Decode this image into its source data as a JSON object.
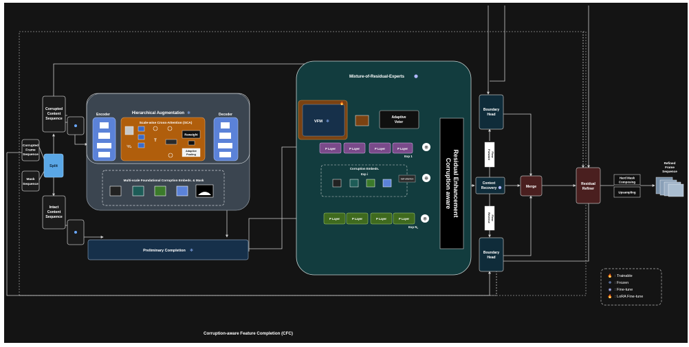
{
  "colors": {
    "canvas": "#141414",
    "panel_gray": "#3b4550",
    "panel_teal": "#123c3e",
    "box_dark": "#1b1b1b",
    "navy": "#16304a",
    "moe_box": "#0f2c3a",
    "orange": "#b05e0c",
    "encoder_blue": "#5b82d8",
    "split_blue": "#5aa7e6",
    "purple": "#7a4a8a",
    "green": "#3f6a1e",
    "maroon": "#4a1f1f",
    "line": "#cfcfcf"
  },
  "labels": {
    "corrupted_content_sequence": [
      "Corrupted",
      "Content",
      "Sequence"
    ],
    "corrupted_frame_sequence": [
      "Corrupted",
      "Frame",
      "Sequence"
    ],
    "mask_sequence": [
      "Mask",
      "Sequence"
    ],
    "split": "Split",
    "intact_content_sequence": [
      "Intact",
      "Content",
      "Sequence"
    ],
    "hierarchical_augmentation": "Hierarchical Augmentation",
    "encoder": "Encoder",
    "decoder": "Decoder",
    "sca": "Scale-wise Cross-Attention (SCA)",
    "reweight": "Reweight",
    "adaptive_pooling": [
      "Adaptive",
      "Pooling"
    ],
    "t_symbol": "T",
    "multiscale_embeds": "Multi-scale Foundational Corruption Embeds. & Mask",
    "preliminary_completion": "Preliminary Completion",
    "moe_title": "Mixture-of-Residual-Experts",
    "vfm": "VFM",
    "adaptive_voter": [
      "Adaptive",
      "Voter"
    ],
    "p_layer": "P Layer",
    "exp_1": "Exp 1",
    "exp_nc": "Exp N",
    "corruption_embeds": "Corruption Embeds.",
    "exp_i": "Exp i",
    "self_attention": "Self-attention",
    "residual_enhancement": [
      "Corruption aware",
      "Residual Enhancement"
    ],
    "boundary_head": [
      "Boundary",
      "Head"
    ],
    "forward_flow": [
      "Forward",
      "Flow"
    ],
    "reverse_flow": [
      "Reverse",
      "Flow"
    ],
    "context_recovery": [
      "Context",
      "Recovery"
    ],
    "merge": "Merge",
    "residual_refiner": [
      "Residual",
      "Refiner"
    ],
    "hard_mask_composing": [
      "Hard Mask",
      "Composing"
    ],
    "upsampling": "Upsampling",
    "refined_frame_sequence": [
      "Refined",
      "Frame",
      "Sequence"
    ],
    "cfc_title": "Corruption-aware Feature Completion (CFC)"
  },
  "legend": [
    {
      "icon": "flame-icon",
      "glyph": "🔥",
      "label": ": Trainable"
    },
    {
      "icon": "snowflake-icon",
      "glyph": "❄",
      "label": ": Frozen"
    },
    {
      "icon": "fine-tune-icon",
      "glyph": "◉",
      "label": ": Fine-tune"
    },
    {
      "icon": "lora-icon",
      "glyph": "🔥",
      "label": ": LoRA Fine-tune"
    }
  ]
}
